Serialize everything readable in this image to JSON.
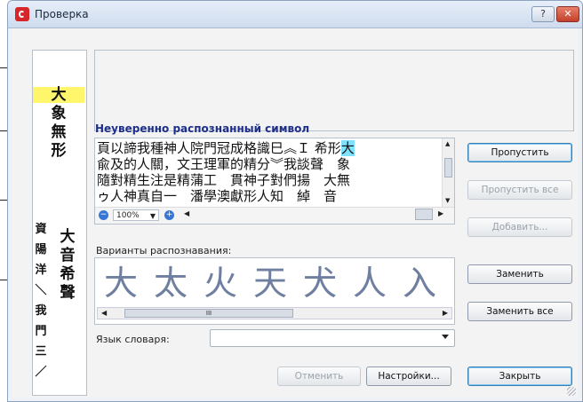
{
  "window": {
    "title": "Проверка",
    "help_label": "?",
    "close_label": "✕"
  },
  "strip": {
    "top_glyphs": [
      "大",
      "象",
      "無",
      "形"
    ],
    "bottom_glyphs": [
      "大",
      "音",
      "希",
      "聲"
    ],
    "side_glyphs": [
      "資",
      "陽",
      "洋",
      "＼",
      "我",
      "門",
      "三",
      "／"
    ]
  },
  "uncertain_heading": "Неуверенно распознанный символ",
  "text_view": {
    "lines": [
      "頁以諦我種神人院門冠成格識巳︽Ｉ 希形",
      "兪及的人關，文王理軍的精分︾我談聲　象",
      "隨對精生注是精蒲工　貫神子對們揚　大無",
      "ゥ人神真自一　潘學澳獻形人知　綽　音"
    ],
    "highlight_char": "大",
    "zoom": "100%"
  },
  "variants": {
    "label": "Варианты распознавания:",
    "items": [
      "大",
      "太",
      "火",
      "天",
      "犬",
      "人",
      "入"
    ],
    "scroll_grip": "III"
  },
  "dictionary": {
    "label": "Язык словаря:",
    "value": ""
  },
  "buttons": {
    "skip": "Пропустить",
    "skip_all": "Пропустить все",
    "add": "Добавить...",
    "replace": "Заменить",
    "replace_all": "Заменить все",
    "undo": "Отменить",
    "settings": "Настройки...",
    "close": "Закрыть"
  }
}
